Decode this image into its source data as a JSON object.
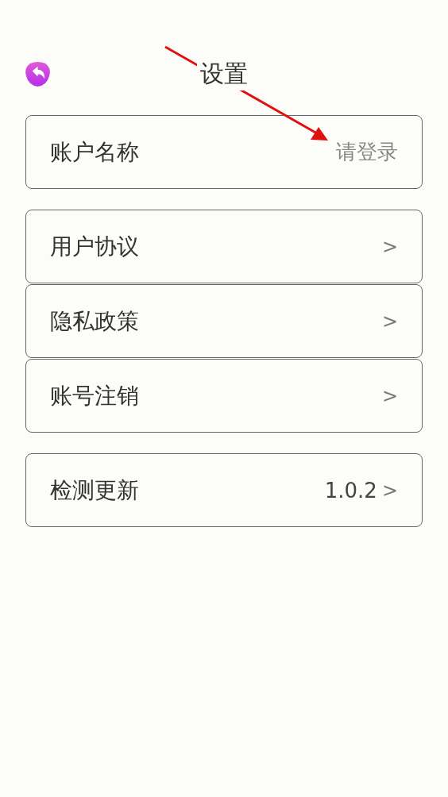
{
  "header": {
    "title": "设置"
  },
  "groups": [
    [
      {
        "label": "账户名称",
        "value": "请登录"
      }
    ],
    [
      {
        "label": "用户协议",
        "chevron": ">"
      },
      {
        "label": "隐私政策",
        "chevron": ">"
      },
      {
        "label": "账号注销",
        "chevron": ">"
      }
    ],
    [
      {
        "label": "检测更新",
        "value": "1.0.2",
        "chevron": ">"
      }
    ]
  ]
}
